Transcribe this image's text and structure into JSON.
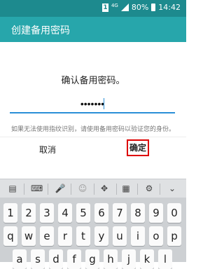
{
  "status": {
    "sim": "1",
    "network": "4G",
    "battery": "80%",
    "time": "14:42"
  },
  "appbar": {
    "title": "创建备用密码"
  },
  "prompt": "确认备用密码。",
  "password": {
    "value": "•••••••"
  },
  "hint": "如果无法使用指纹识别，请使用备用密码以验证您的身份。",
  "buttons": {
    "cancel": "取消",
    "ok": "确定"
  },
  "keyboard": {
    "row1": [
      "1",
      "2",
      "3",
      "4",
      "5",
      "6",
      "7",
      "8",
      "9",
      "0"
    ],
    "row2": [
      "q",
      "w",
      "e",
      "r",
      "t",
      "y",
      "u",
      "i",
      "o",
      "p"
    ],
    "row3": [
      "a",
      "s",
      "d",
      "f",
      "g",
      "h",
      "j",
      "k",
      "l"
    ]
  }
}
